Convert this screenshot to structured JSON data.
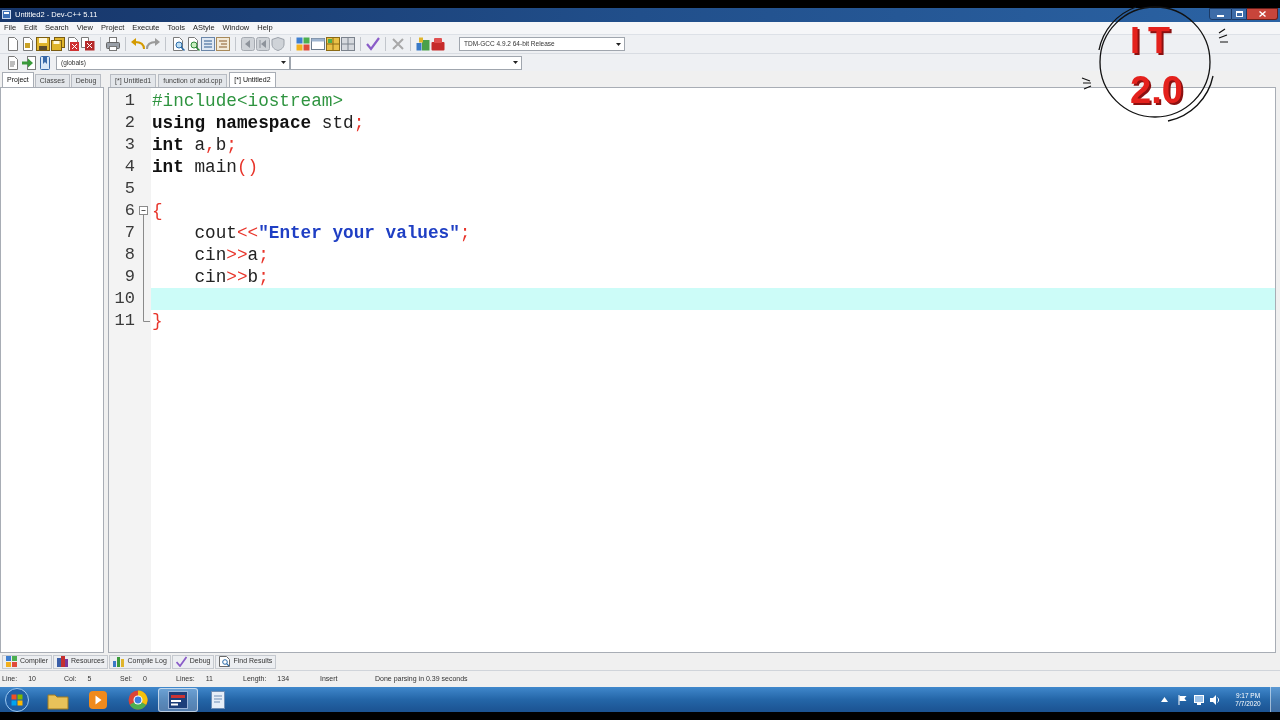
{
  "window": {
    "title": "Untitled2 - Dev-C++ 5.11"
  },
  "menu": [
    "File",
    "Edit",
    "Search",
    "View",
    "Project",
    "Execute",
    "Tools",
    "AStyle",
    "Window",
    "Help"
  ],
  "toolbar": {
    "compiler": "TDM-GCC 4.9.2 64-bit Release",
    "scope": "(globals)"
  },
  "side_panel": {
    "tabs": [
      {
        "label": "Project",
        "selected": true
      },
      {
        "label": "Classes",
        "selected": false
      },
      {
        "label": "Debug",
        "selected": false
      }
    ]
  },
  "editor": {
    "tabs": [
      {
        "label": "[*] Untitled1",
        "selected": false
      },
      {
        "label": "function of add.cpp",
        "selected": false
      },
      {
        "label": "[*] Untitled2",
        "selected": true
      }
    ],
    "lines": [
      {
        "number": "1",
        "current": false,
        "tokens": [
          {
            "kind": "preprocessor",
            "text": "#include<iostream>"
          }
        ]
      },
      {
        "number": "2",
        "current": false,
        "tokens": [
          {
            "kind": "keyword",
            "text": "using namespace"
          },
          {
            "kind": "plain",
            "text": " std"
          },
          {
            "kind": "symbol",
            "text": ";"
          }
        ]
      },
      {
        "number": "3",
        "current": false,
        "tokens": [
          {
            "kind": "keyword",
            "text": "int"
          },
          {
            "kind": "plain",
            "text": " a"
          },
          {
            "kind": "symbol",
            "text": ","
          },
          {
            "kind": "plain",
            "text": "b"
          },
          {
            "kind": "symbol",
            "text": ";"
          }
        ]
      },
      {
        "number": "4",
        "current": false,
        "tokens": [
          {
            "kind": "keyword",
            "text": "int"
          },
          {
            "kind": "plain",
            "text": " main"
          },
          {
            "kind": "symbol",
            "text": "()"
          }
        ]
      },
      {
        "number": "5",
        "current": false
      },
      {
        "number": "6",
        "current": false,
        "expanded": true,
        "tokens": [
          {
            "kind": "symbol",
            "text": "{"
          }
        ],
        "children": [
          {
            "number": "7",
            "current": false,
            "tokens": [
              {
                "kind": "plain",
                "text": "    cout"
              },
              {
                "kind": "symbol",
                "text": "<<"
              },
              {
                "kind": "string",
                "text": "\"Enter your values\""
              },
              {
                "kind": "symbol",
                "text": ";"
              }
            ]
          },
          {
            "number": "8",
            "current": false,
            "tokens": [
              {
                "kind": "plain",
                "text": "    cin"
              },
              {
                "kind": "symbol",
                "text": ">>"
              },
              {
                "kind": "plain",
                "text": "a"
              },
              {
                "kind": "symbol",
                "text": ";"
              }
            ]
          },
          {
            "number": "9",
            "current": false,
            "tokens": [
              {
                "kind": "plain",
                "text": "    cin"
              },
              {
                "kind": "symbol",
                "text": ">>"
              },
              {
                "kind": "plain",
                "text": "b"
              },
              {
                "kind": "symbol",
                "text": ";"
              }
            ]
          },
          {
            "number": "10",
            "current": true
          },
          {
            "number": "11",
            "current": false,
            "tokens": [
              {
                "kind": "symbol",
                "text": "}"
              }
            ]
          }
        ]
      }
    ]
  },
  "bottom_panel": {
    "tabs": [
      {
        "label": "Compiler",
        "selected": false
      },
      {
        "label": "Resources",
        "selected": false
      },
      {
        "label": "Compile Log",
        "selected": false
      },
      {
        "label": "Debug",
        "selected": false
      },
      {
        "label": "Find Results",
        "selected": false
      }
    ]
  },
  "status_bar": [
    {
      "label": "Line:",
      "value": "10"
    },
    {
      "label": "Col:",
      "value": "5"
    },
    {
      "label": "Sel:",
      "value": "0"
    },
    {
      "label": "Lines:",
      "value": "11"
    },
    {
      "label": "Length:",
      "value": "134"
    },
    {
      "text": "Insert"
    },
    {
      "text": "Done parsing in 0.39 seconds"
    }
  ],
  "taskbar": {
    "apps": [
      {
        "active": false
      },
      {
        "active": false
      },
      {
        "active": false
      },
      {
        "active": true
      },
      {
        "active": false
      }
    ],
    "clock": {
      "time": "9:17 PM",
      "date": "7/7/2020"
    }
  },
  "channel_logo": {
    "line_1": "IT",
    "line_2": "2.0"
  }
}
